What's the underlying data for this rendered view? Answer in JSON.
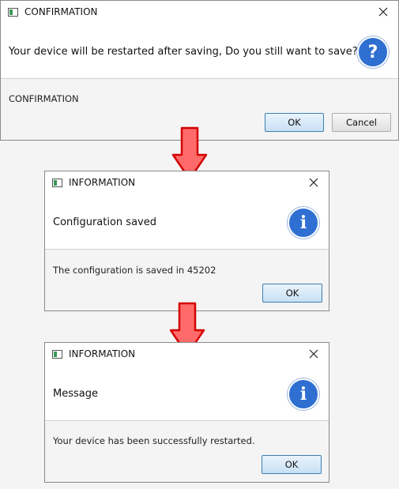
{
  "dialogs": {
    "confirmation": {
      "title": "CONFIRMATION",
      "header": "Your device will be restarted after saving, Do you still want to save?",
      "content": "CONFIRMATION",
      "icon": "question-icon",
      "ok_label": "OK",
      "cancel_label": "Cancel"
    },
    "info_saved": {
      "title": "INFORMATION",
      "header": "Configuration saved",
      "content": "The configuration is saved in 45202",
      "icon": "info-icon",
      "ok_label": "OK"
    },
    "info_restarted": {
      "title": "INFORMATION",
      "header": "Message",
      "content": "Your device has been successfully restarted.",
      "icon": "info-icon",
      "ok_label": "OK"
    }
  },
  "colors": {
    "arrow_fill": "#ff6b6b",
    "arrow_stroke": "#d40000",
    "icon_blue": "#2f6fd1",
    "default_button_border": "#3c7fb1"
  }
}
